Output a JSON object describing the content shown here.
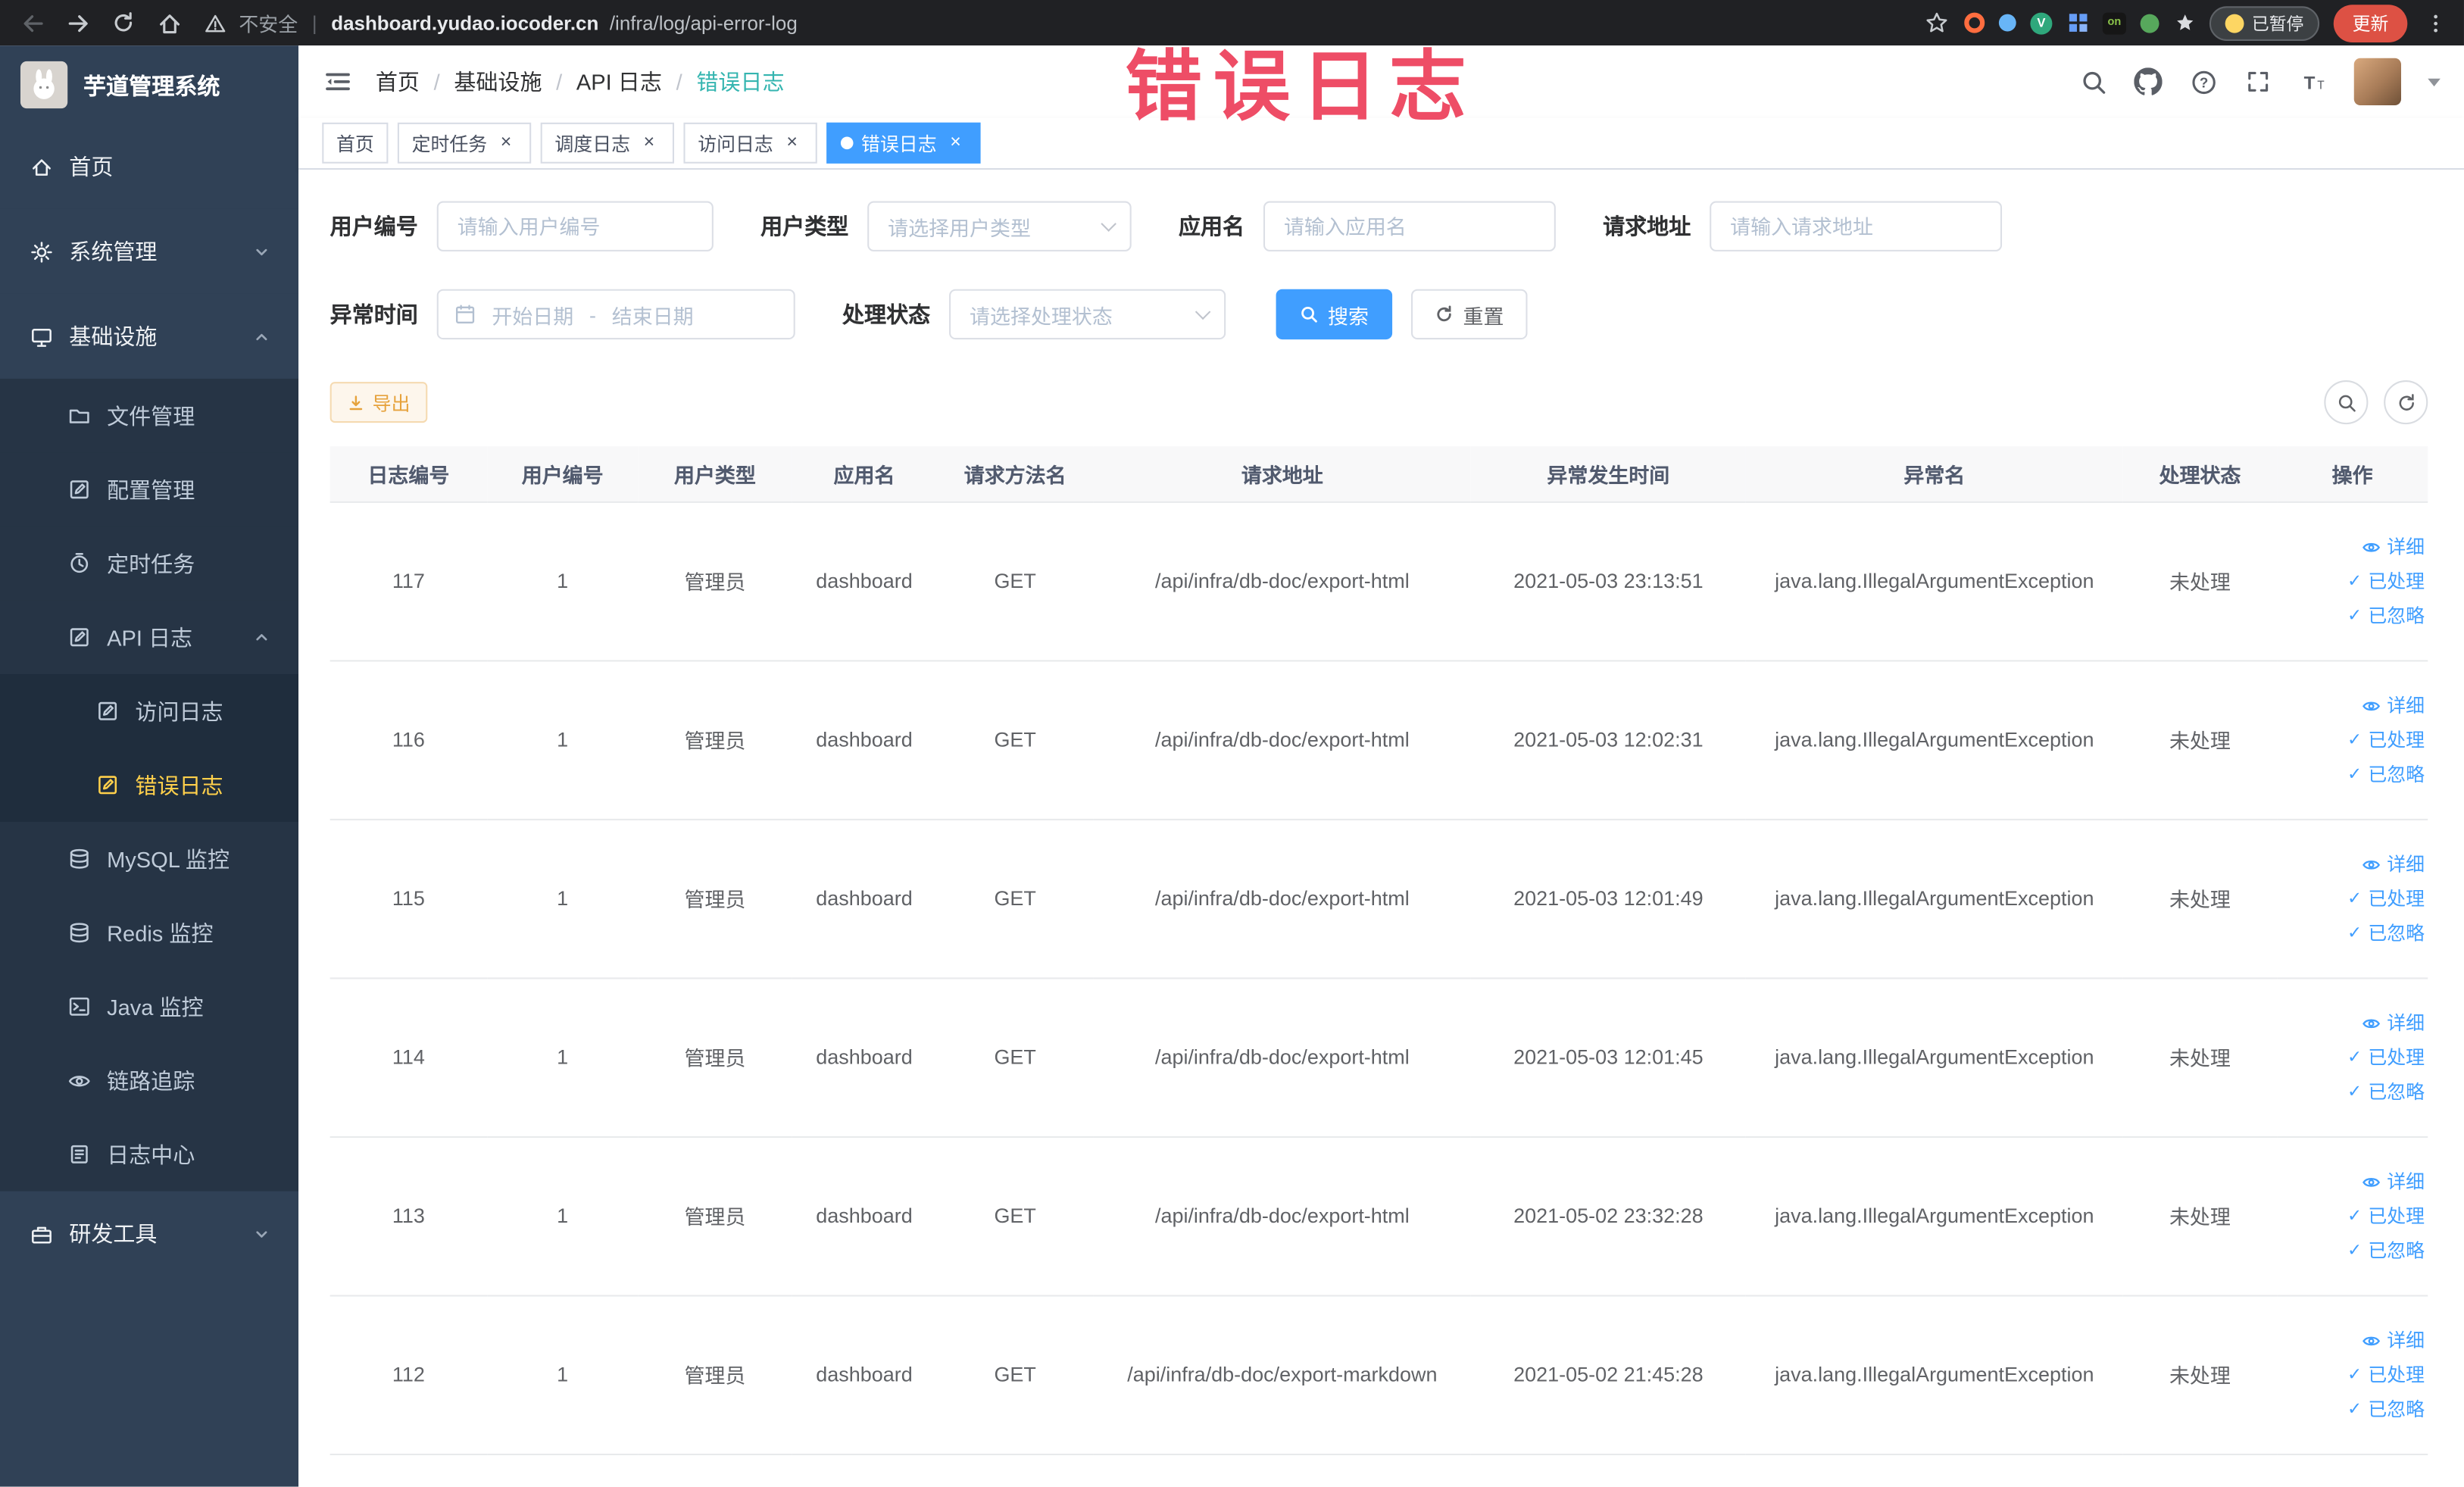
{
  "annotation": {
    "overlay_title": "错误日志"
  },
  "browser": {
    "security_label": "不安全",
    "url_host": "dashboard.yudao.iocoder.cn",
    "url_path": "/infra/log/api-error-log",
    "paused_badge": "已暂停",
    "update_label": "更新"
  },
  "sidebar": {
    "app_title": "芋道管理系统",
    "menu": [
      {
        "label": "首页",
        "level": 1,
        "icon": "home"
      },
      {
        "label": "系统管理",
        "level": 1,
        "icon": "gear",
        "arrow": "down"
      },
      {
        "label": "基础设施",
        "level": 1,
        "icon": "monitor",
        "arrow": "up"
      },
      {
        "label": "文件管理",
        "level": 2,
        "icon": "folder"
      },
      {
        "label": "配置管理",
        "level": 2,
        "icon": "edit"
      },
      {
        "label": "定时任务",
        "level": 2,
        "icon": "timer"
      },
      {
        "label": "API 日志",
        "level": 2,
        "icon": "edit",
        "arrow": "up"
      },
      {
        "label": "访问日志",
        "level": 3,
        "icon": "edit"
      },
      {
        "label": "错误日志",
        "level": 3,
        "icon": "edit",
        "active": true
      },
      {
        "label": "MySQL 监控",
        "level": 2,
        "icon": "db"
      },
      {
        "label": "Redis 监控",
        "level": 2,
        "icon": "db"
      },
      {
        "label": "Java 监控",
        "level": 2,
        "icon": "java"
      },
      {
        "label": "链路追踪",
        "level": 2,
        "icon": "eye"
      },
      {
        "label": "日志中心",
        "level": 2,
        "icon": "doc"
      },
      {
        "label": "研发工具",
        "level": 1,
        "icon": "tools",
        "arrow": "down"
      }
    ]
  },
  "header": {
    "breadcrumb": [
      {
        "label": "首页"
      },
      {
        "label": "基础设施"
      },
      {
        "label": "API 日志"
      },
      {
        "label": "错误日志",
        "current": true
      }
    ]
  },
  "tags": [
    {
      "label": "首页",
      "closable": false,
      "active": false
    },
    {
      "label": "定时任务",
      "closable": true,
      "active": false
    },
    {
      "label": "调度日志",
      "closable": true,
      "active": false
    },
    {
      "label": "访问日志",
      "closable": true,
      "active": false
    },
    {
      "label": "错误日志",
      "closable": true,
      "active": true
    }
  ],
  "filters": {
    "user_id": {
      "label": "用户编号",
      "placeholder": "请输入用户编号"
    },
    "user_type": {
      "label": "用户类型",
      "placeholder": "请选择用户类型"
    },
    "app_name": {
      "label": "应用名",
      "placeholder": "请输入应用名"
    },
    "request_url": {
      "label": "请求地址",
      "placeholder": "请输入请求地址"
    },
    "exception_time": {
      "label": "异常时间",
      "start_placeholder": "开始日期",
      "separator": "-",
      "end_placeholder": "结束日期"
    },
    "process_status": {
      "label": "处理状态",
      "placeholder": "请选择处理状态"
    },
    "search_button": "搜索",
    "reset_button": "重置"
  },
  "toolbar": {
    "export_button": "导出"
  },
  "table": {
    "columns": [
      "日志编号",
      "用户编号",
      "用户类型",
      "应用名",
      "请求方法名",
      "请求地址",
      "异常发生时间",
      "异常名",
      "处理状态",
      "操作"
    ],
    "rows": [
      {
        "log_id": "117",
        "user_id": "1",
        "user_type": "管理员",
        "app_name": "dashboard",
        "method": "GET",
        "url": "/api/infra/db-doc/export-html",
        "time": "2021-05-03 23:13:51",
        "exception": "java.lang.IllegalArgumentException",
        "status": "未处理"
      },
      {
        "log_id": "116",
        "user_id": "1",
        "user_type": "管理员",
        "app_name": "dashboard",
        "method": "GET",
        "url": "/api/infra/db-doc/export-html",
        "time": "2021-05-03 12:02:31",
        "exception": "java.lang.IllegalArgumentException",
        "status": "未处理"
      },
      {
        "log_id": "115",
        "user_id": "1",
        "user_type": "管理员",
        "app_name": "dashboard",
        "method": "GET",
        "url": "/api/infra/db-doc/export-html",
        "time": "2021-05-03 12:01:49",
        "exception": "java.lang.IllegalArgumentException",
        "status": "未处理"
      },
      {
        "log_id": "114",
        "user_id": "1",
        "user_type": "管理员",
        "app_name": "dashboard",
        "method": "GET",
        "url": "/api/infra/db-doc/export-html",
        "time": "2021-05-03 12:01:45",
        "exception": "java.lang.IllegalArgumentException",
        "status": "未处理"
      },
      {
        "log_id": "113",
        "user_id": "1",
        "user_type": "管理员",
        "app_name": "dashboard",
        "method": "GET",
        "url": "/api/infra/db-doc/export-html",
        "time": "2021-05-02 23:32:28",
        "exception": "java.lang.IllegalArgumentException",
        "status": "未处理"
      },
      {
        "log_id": "112",
        "user_id": "1",
        "user_type": "管理员",
        "app_name": "dashboard",
        "method": "GET",
        "url": "/api/infra/db-doc/export-markdown",
        "time": "2021-05-02 21:45:28",
        "exception": "java.lang.IllegalArgumentException",
        "status": "未处理"
      }
    ],
    "row_actions": [
      "详细",
      "已处理",
      "已忽略"
    ]
  }
}
